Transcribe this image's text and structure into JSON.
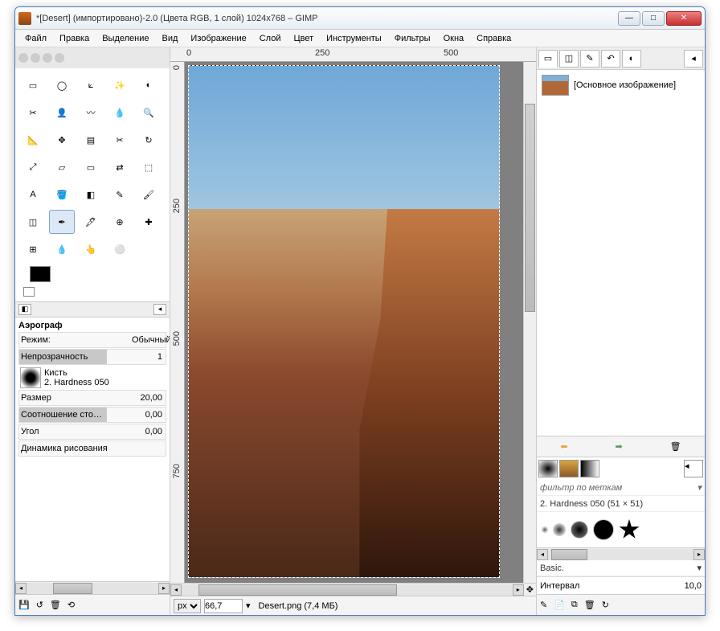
{
  "window": {
    "title": "*[Desert] (импортировано)-2.0 (Цвета RGB, 1 слой) 1024x768 – GIMP"
  },
  "menu": [
    "Файл",
    "Правка",
    "Выделение",
    "Вид",
    "Изображение",
    "Слой",
    "Цвет",
    "Инструменты",
    "Фильтры",
    "Окна",
    "Справка"
  ],
  "toolbox": {
    "tools": [
      "rect-select",
      "ellipse-select",
      "lasso",
      "wand",
      "color-select",
      "scissors",
      "foreground-select",
      "paths",
      "color-picker",
      "zoom",
      "measure",
      "move",
      "align",
      "crop",
      "rotate",
      "scale",
      "shear",
      "perspective",
      "flip",
      "cage",
      "text",
      "bucket",
      "blend",
      "pencil",
      "brush",
      "eraser",
      "airbrush",
      "ink",
      "clone",
      "heal",
      "perspective-clone",
      "blur",
      "smudge",
      "dodge"
    ],
    "active_tool": "airbrush",
    "fg": "#000000",
    "bg": "#ffffff"
  },
  "tool_options": {
    "title": "Аэрограф",
    "mode_label": "Режим:",
    "mode_value": "Обычный",
    "opacity_label": "Непрозрачность",
    "opacity_value": "1",
    "brush_label": "Кисть",
    "brush_name": "2. Hardness 050",
    "size_label": "Размер",
    "size_value": "20,00",
    "ratio_label": "Соотношение сто…",
    "ratio_value": "0,00",
    "angle_label": "Угол",
    "angle_value": "0,00",
    "dynamics_label": "Динамика рисования"
  },
  "canvas": {
    "ruler_marks_h": [
      "0",
      "250",
      "500"
    ],
    "ruler_marks_v": [
      "0",
      "250",
      "500",
      "750"
    ]
  },
  "statusbar": {
    "unit": "px",
    "zoom": "66,7",
    "filename": "Desert.png (7,4 МБ)"
  },
  "layers": {
    "items": [
      {
        "name": "[Основное изображение]"
      }
    ]
  },
  "brushes": {
    "filter_placeholder": "фильтр по меткам",
    "active": "2. Hardness 050 (51 × 51)",
    "preset_label": "Basic.",
    "interval_label": "Интервал",
    "interval_value": "10,0"
  }
}
